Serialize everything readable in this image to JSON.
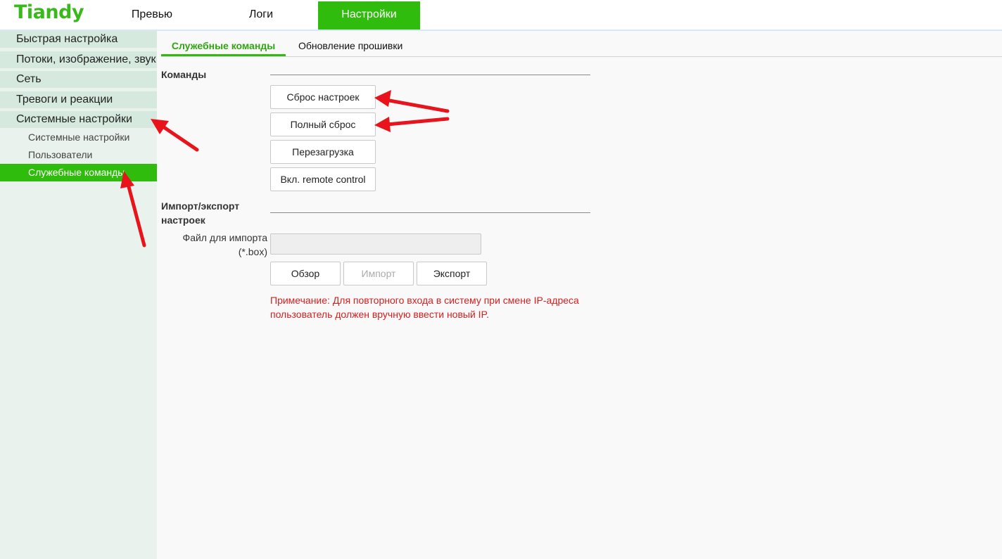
{
  "brand": {
    "logo_text": "Tiandy",
    "accent_color": "#2fbc0c"
  },
  "topnav": {
    "preview": "Превью",
    "logs": "Логи",
    "settings": "Настройки"
  },
  "sidebar": {
    "items": [
      {
        "label": "Быстрая настройка"
      },
      {
        "label": "Потоки, изображение, звук"
      },
      {
        "label": "Сеть"
      },
      {
        "label": "Тревоги и реакции"
      },
      {
        "label": "Системные настройки"
      }
    ],
    "subitems": [
      {
        "label": "Системные настройки"
      },
      {
        "label": "Пользователи"
      },
      {
        "label": "Служебные команды"
      }
    ]
  },
  "tabs": {
    "service": "Служебные команды",
    "firmware": "Обновление прошивки"
  },
  "commands": {
    "title": "Команды",
    "reset_settings": "Сброс настроек",
    "full_reset": "Полный сброс",
    "reboot": "Перезагрузка",
    "remote_control": "Вкл. remote control"
  },
  "import_export": {
    "title_line1": "Импорт/экспорт",
    "title_line2": "настроек",
    "file_label_line1": "Файл для импорта",
    "file_label_line2": "(*.box)",
    "file_value": "",
    "browse": "Обзор",
    "import": "Импорт",
    "export": "Экспорт"
  },
  "note": {
    "line1": "Примечание: Для повторного входа в систему при смене IP-адреса",
    "line2": "пользователь должен вручную ввести новый IP."
  },
  "annotation_color": "#e8131b"
}
